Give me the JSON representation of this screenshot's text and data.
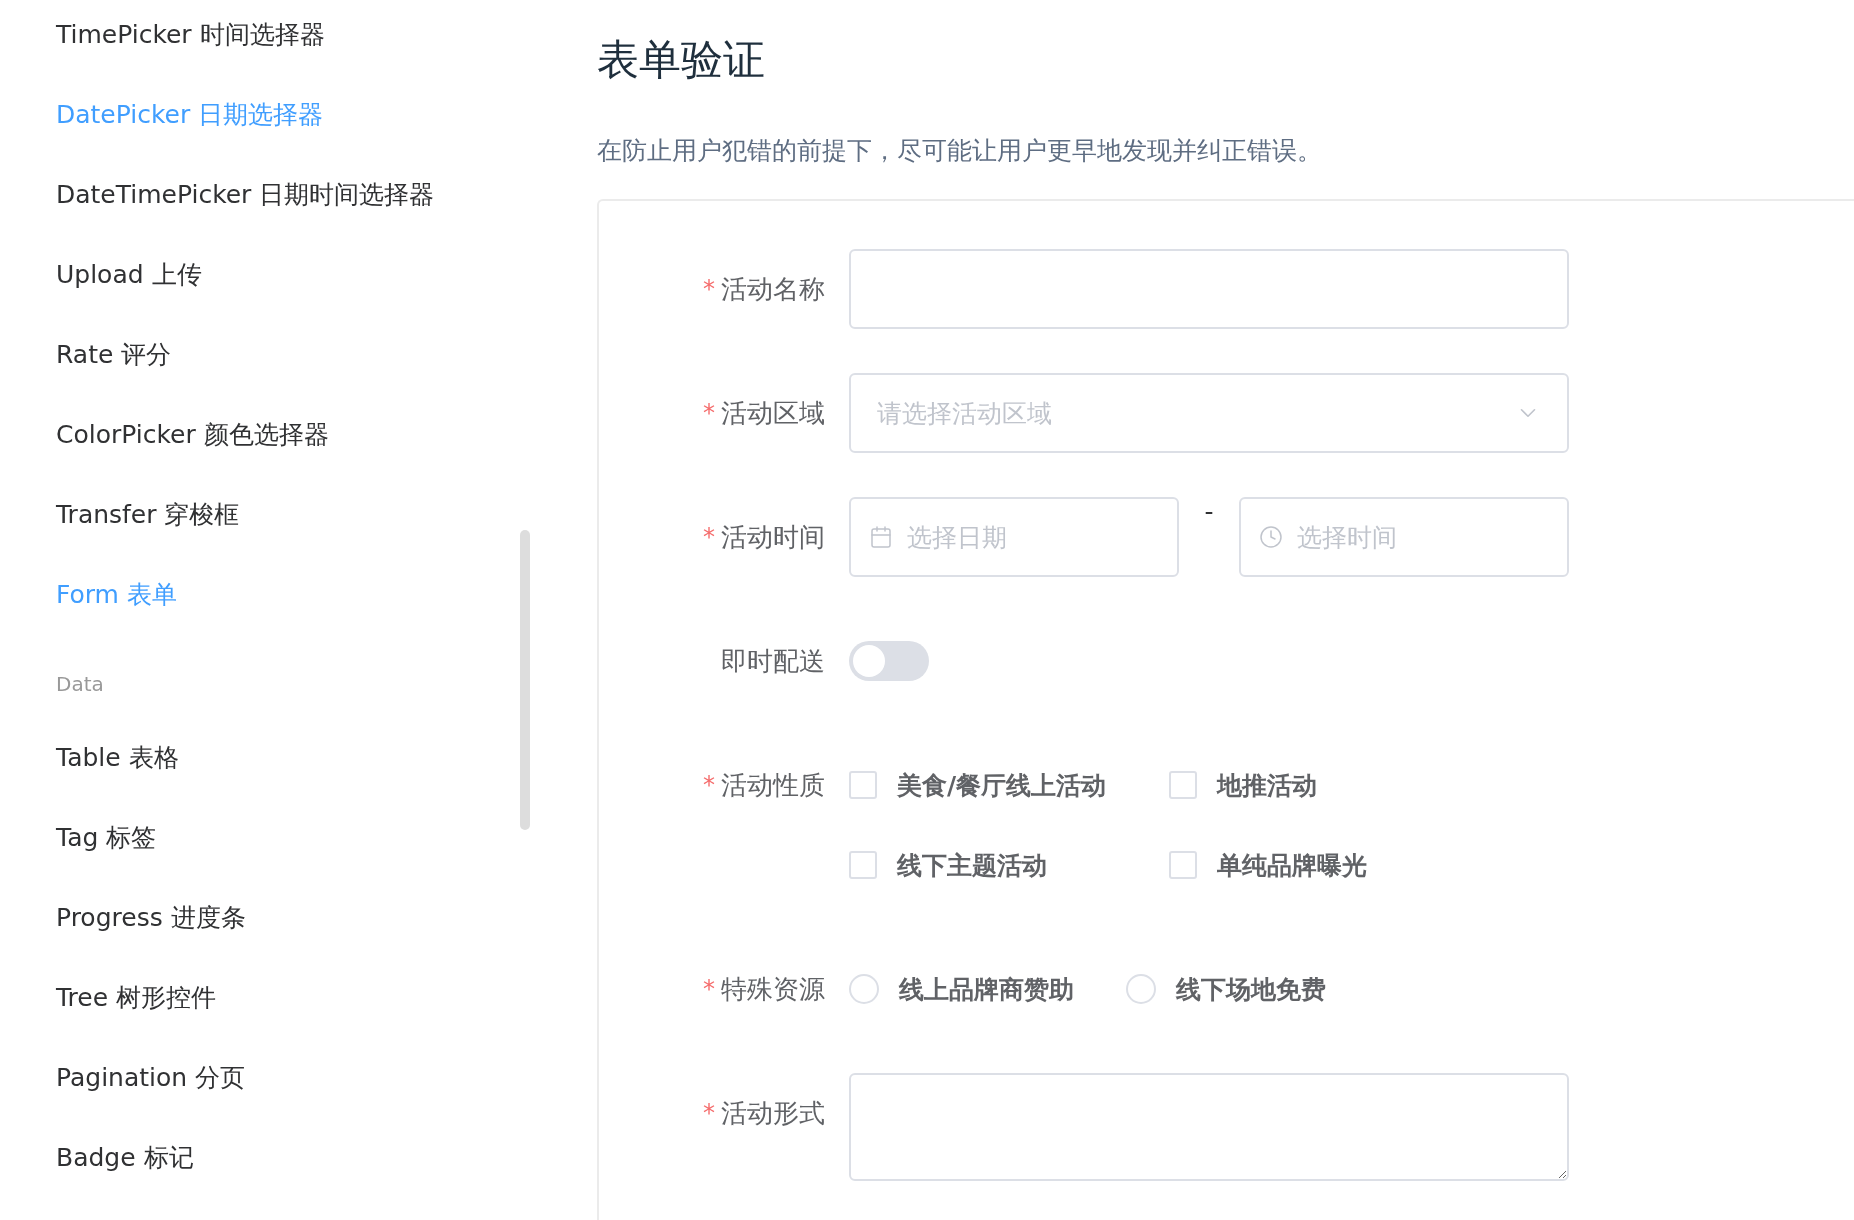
{
  "sidebar": {
    "items": [
      {
        "kind": "link",
        "label": "TimePicker 时间选择器",
        "selected": false
      },
      {
        "kind": "link",
        "label": "DatePicker 日期选择器",
        "selected": true
      },
      {
        "kind": "link",
        "label": "DateTimePicker 日期时间选择器",
        "selected": false
      },
      {
        "kind": "link",
        "label": "Upload 上传",
        "selected": false
      },
      {
        "kind": "link",
        "label": "Rate 评分",
        "selected": false
      },
      {
        "kind": "link",
        "label": "ColorPicker 颜色选择器",
        "selected": false
      },
      {
        "kind": "link",
        "label": "Transfer 穿梭框",
        "selected": false
      },
      {
        "kind": "link",
        "label": "Form 表单",
        "selected": true
      },
      {
        "kind": "group",
        "label": "Data"
      },
      {
        "kind": "link",
        "label": "Table 表格",
        "selected": false
      },
      {
        "kind": "link",
        "label": "Tag 标签",
        "selected": false
      },
      {
        "kind": "link",
        "label": "Progress 进度条",
        "selected": false
      },
      {
        "kind": "link",
        "label": "Tree 树形控件",
        "selected": false
      },
      {
        "kind": "link",
        "label": "Pagination 分页",
        "selected": false
      },
      {
        "kind": "link",
        "label": "Badge 标记",
        "selected": false
      }
    ]
  },
  "page": {
    "title": "表单验证",
    "description": "在防止用户犯错的前提下，尽可能让用户更早地发现并纠正错误。"
  },
  "form": {
    "fields": [
      {
        "kind": "input",
        "marker": "*",
        "label": "活动名称"
      },
      {
        "kind": "select",
        "marker": "*",
        "label": "活动区域",
        "placeholder": "请选择活动区域"
      },
      {
        "kind": "datetime",
        "marker": "*",
        "label": "活动时间",
        "date_placeholder": "选择日期",
        "separator": "-",
        "time_placeholder": "选择时间"
      },
      {
        "kind": "switch",
        "label": "即时配送",
        "on": false
      },
      {
        "kind": "checkboxes",
        "marker": "*",
        "label": "活动性质",
        "options": [
          {
            "label": "美食/餐厅线上活动",
            "checked": false
          },
          {
            "label": "地推活动",
            "checked": false
          },
          {
            "label": "线下主题活动",
            "checked": false
          },
          {
            "label": "单纯品牌曝光",
            "checked": false
          }
        ]
      },
      {
        "kind": "radios",
        "marker": "*",
        "label": "特殊资源",
        "options": [
          {
            "label": "线上品牌商赞助",
            "selected": false
          },
          {
            "label": "线下场地免费",
            "selected": false
          }
        ]
      },
      {
        "kind": "textarea",
        "marker": "*",
        "label": "活动形式"
      }
    ]
  }
}
